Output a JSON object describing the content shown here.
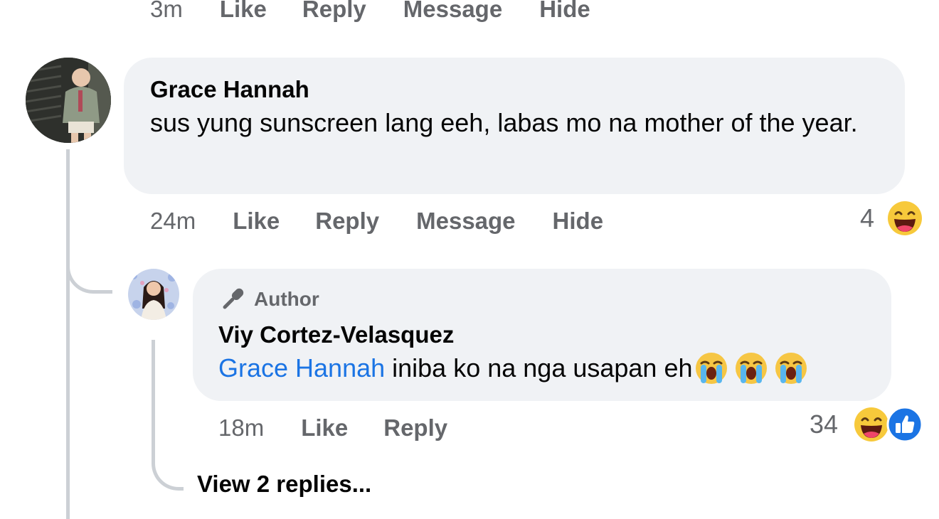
{
  "top_actions": {
    "time": "3m",
    "like": "Like",
    "reply": "Reply",
    "message": "Message",
    "hide": "Hide"
  },
  "comment": {
    "author": "Grace Hannah",
    "text": "sus yung sunscreen lang eeh, labas mo na mother of the year.",
    "actions": {
      "time": "24m",
      "like": "Like",
      "reply": "Reply",
      "message": "Message",
      "hide": "Hide"
    },
    "reaction_count": "4",
    "reaction_icons": [
      "haha-emoji-icon"
    ]
  },
  "reply": {
    "badge": "Author",
    "author": "Viy Cortez-Velasquez",
    "mention": "Grace Hannah",
    "text": " iniba ko na nga usapan eh",
    "emojis": [
      "crying-face-emoji-icon",
      "crying-face-emoji-icon",
      "crying-face-emoji-icon"
    ],
    "actions": {
      "time": "18m",
      "like": "Like",
      "reply": "Reply"
    },
    "reaction_count": "34",
    "reaction_icons": [
      "haha-emoji-icon",
      "like-icon"
    ]
  },
  "view_replies": "View 2 replies...",
  "colors": {
    "bubble": "#f0f2f5",
    "secondary_text": "#65676b",
    "mention": "#1b74e4",
    "thread_line": "#ccd0d5"
  }
}
